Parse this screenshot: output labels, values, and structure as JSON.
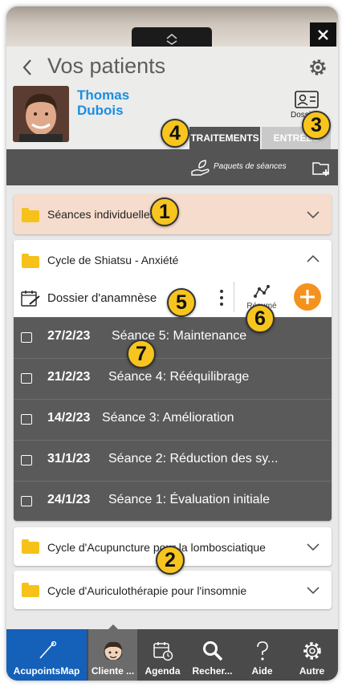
{
  "header": {
    "title": "Vos patients"
  },
  "patient": {
    "first_name": "Thomas",
    "last_name": "Dubois",
    "dossier_label": "Dossier"
  },
  "tabs": [
    {
      "label": "TRAITEMENTS"
    },
    {
      "label": "ENTRÉES"
    }
  ],
  "toolbar": {
    "packages_label": "Paquets de séances"
  },
  "cycles": {
    "individual": {
      "label": "Séances individuelles"
    },
    "shiatsu": {
      "label": "Cycle de Shiatsu - Anxiété"
    },
    "acupuncture": {
      "label": "Cycle d'Acupuncture pour la lombosciatique"
    },
    "auriculo": {
      "label": "Cycle d'Auriculothérapie pour l'insomnie"
    }
  },
  "anamnese": {
    "label": "Dossier d'anamnèse",
    "resume_label": "Résumé"
  },
  "sessions": [
    {
      "date": "27/2/23",
      "title": "Séance 5: Maintenance"
    },
    {
      "date": "21/2/23",
      "title": "Séance 4: Rééquilibrage"
    },
    {
      "date": "14/2/23",
      "title": "Séance 3: Amélioration"
    },
    {
      "date": "31/1/23",
      "title": "Séance 2: Réduction des sy..."
    },
    {
      "date": "24/1/23",
      "title": "Séance 1: Évaluation initiale"
    }
  ],
  "badges": [
    "1",
    "2",
    "3",
    "4",
    "5",
    "6",
    "7"
  ],
  "tabbar": [
    {
      "label": "AcupointsMap",
      "icon": "acupuncture-needle-icon"
    },
    {
      "label": "Cliente ...",
      "icon": "client-face-icon"
    },
    {
      "label": "Agenda",
      "icon": "calendar-clock-icon"
    },
    {
      "label": "Recher...",
      "icon": "search-icon"
    },
    {
      "label": "Aide",
      "icon": "help-icon"
    },
    {
      "label": "Autre",
      "icon": "gear-icon"
    }
  ],
  "colors": {
    "accent_blue": "#1a8fe0",
    "tab_active_bg": "#1560b8",
    "badge_yellow": "#f7c51d",
    "add_orange": "#f5921e",
    "dark_panel": "#545454"
  }
}
